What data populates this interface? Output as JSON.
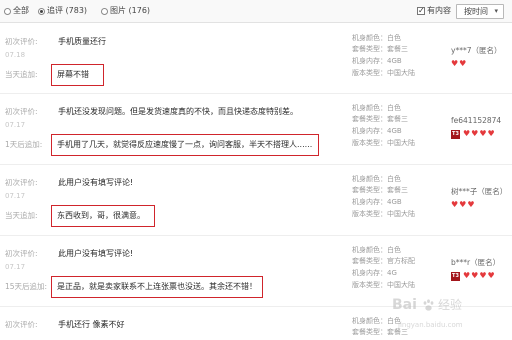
{
  "filter_bar": {
    "radios": [
      {
        "label": "全部",
        "selected": false
      },
      {
        "label": "追评 (783)",
        "selected": true
      },
      {
        "label": "图片 (176)",
        "selected": false
      }
    ],
    "has_content": {
      "label": "有内容",
      "checked": true
    },
    "sort": {
      "label": "按时间",
      "icon": "chevron-down-icon"
    }
  },
  "reviews": [
    {
      "first_label": "初次评价:",
      "first_text": "手机质量还行",
      "date": "07.18",
      "append_label": "当天追加:",
      "append_text": "屏幕不错",
      "attrs": [
        "机身颜色：白色",
        "套餐类型：套餐三",
        "机身内存：4GB",
        "版本类型：中国大陆"
      ],
      "user": "y***7（匿名）",
      "badge": "",
      "hearts": 2
    },
    {
      "first_label": "初次评价:",
      "first_text": "手机还没发现问题。但是发货速度真的不快，而且快递态度特别差。",
      "date": "07.17",
      "append_label": "1天后追加:",
      "append_text": "手机用了几天，就觉得反应速度慢了一点，询问客服，半天不搭理人......",
      "attrs": [
        "机身颜色：白色",
        "套餐类型：套餐三",
        "机身内存：4GB",
        "版本类型：中国大陆"
      ],
      "user": "fe641152874",
      "badge": "T3",
      "hearts": 4
    },
    {
      "first_label": "初次评价:",
      "first_text": "此用户没有填写评论!",
      "date": "07.17",
      "append_label": "当天追加:",
      "append_text": "东西收到，哥，很满意。",
      "attrs": [
        "机身颜色：白色",
        "套餐类型：套餐三",
        "机身内存：4GB",
        "版本类型：中国大陆"
      ],
      "user": "树***子（匿名）",
      "badge": "",
      "hearts": 3
    },
    {
      "first_label": "初次评价:",
      "first_text": "此用户没有填写评论!",
      "date": "07.17",
      "append_label": "15天后追加:",
      "append_text": "是正品，就是卖家联系不上连张票也没送。其余还不错！",
      "attrs": [
        "机身颜色：白色",
        "套餐类型：官方标配",
        "机身内存：4G",
        "版本类型：中国大陆"
      ],
      "user": "b***r（匿名）",
      "badge": "T3",
      "hearts": 4
    },
    {
      "first_label": "初次评价:",
      "first_text": "手机还行 像素不好",
      "attrs": [
        "机身颜色：白色",
        "套餐类型：套餐三"
      ]
    }
  ],
  "icons": {
    "credit": "heart-icon",
    "level_badge": "buyer-level-badge",
    "watermark_logo": "baidu-paw-icon"
  },
  "colors": {
    "highlight_box": "#d0252c",
    "credit_heart": "#e4393c",
    "level_badge": "#a3161c"
  },
  "watermark": {
    "brand": "Bai",
    "product": "经验",
    "url": "jingyan.baidu.com"
  }
}
